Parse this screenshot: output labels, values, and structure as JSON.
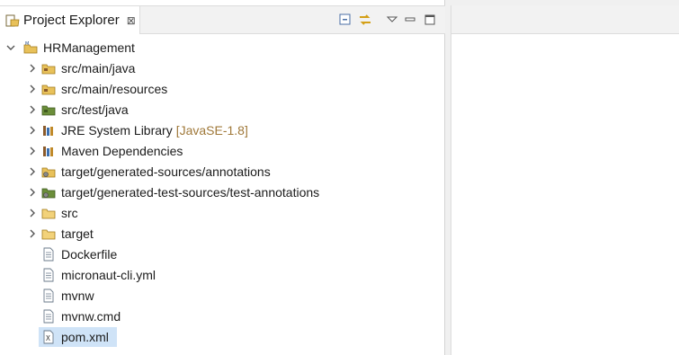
{
  "panel": {
    "title": "Project Explorer",
    "close_glyph": "⊠",
    "toolbar": [
      "collapse-all-icon",
      "link-with-editor-icon",
      "view-menu-icon",
      "minimize-icon",
      "maximize-icon"
    ]
  },
  "tree": {
    "project": "HRManagement",
    "items": [
      {
        "label": "src/main/java",
        "icon": "source-folder-icon",
        "expandable": true
      },
      {
        "label": "src/main/resources",
        "icon": "source-folder-icon",
        "expandable": true
      },
      {
        "label": "src/test/java",
        "icon": "test-source-folder-icon",
        "expandable": true
      },
      {
        "label": "JRE System Library",
        "decoration": "[JavaSE-1.8]",
        "icon": "library-icon",
        "expandable": true
      },
      {
        "label": "Maven Dependencies",
        "icon": "library-icon",
        "expandable": true
      },
      {
        "label": "target/generated-sources/annotations",
        "icon": "generated-source-folder-icon",
        "expandable": true
      },
      {
        "label": "target/generated-test-sources/test-annotations",
        "icon": "generated-source-folder-icon",
        "expandable": true
      },
      {
        "label": "src",
        "icon": "folder-icon",
        "expandable": true
      },
      {
        "label": "target",
        "icon": "folder-icon",
        "expandable": true
      },
      {
        "label": "Dockerfile",
        "icon": "file-icon",
        "expandable": false
      },
      {
        "label": "micronaut-cli.yml",
        "icon": "file-icon",
        "expandable": false
      },
      {
        "label": "mvnw",
        "icon": "file-icon",
        "expandable": false
      },
      {
        "label": "mvnw.cmd",
        "icon": "file-icon",
        "expandable": false
      },
      {
        "label": "pom.xml",
        "icon": "xml-file-icon",
        "expandable": false,
        "selected": true
      }
    ]
  },
  "colors": {
    "selection": "#cfe3f7",
    "decoration": "#a0793a",
    "folder": "#e8c15a"
  }
}
